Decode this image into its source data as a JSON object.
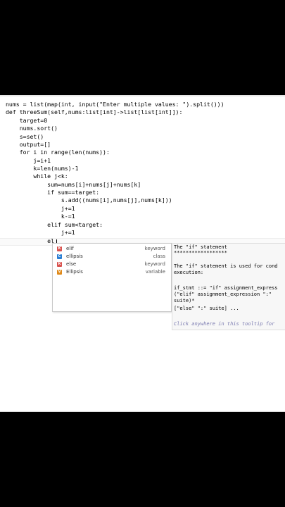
{
  "code": {
    "lines": [
      "nums = list(map(int, input(\"Enter multiple values: \").split()))",
      "def threeSum(self,nums:list[int]->list[list[int]]):",
      "    target=0",
      "    nums.sort()",
      "    s=set()",
      "    output=[]",
      "    for i in range(len(nums)):",
      "        j=i+1",
      "        k=len(nums)-1",
      "        while j<k:",
      "            sum=nums[i]+nums[j]+nums[k]",
      "            if sum==target:",
      "                s.add((nums[i],nums[j],nums[k]))",
      "                j+=1",
      "                k-=1",
      "            elif sum<target:",
      "                j+=1",
      "            el"
    ]
  },
  "completion": {
    "items": [
      {
        "label": "elif",
        "type": "keyword",
        "icon": "keyword-icon",
        "color": "#d9534f"
      },
      {
        "label": "ellipsis",
        "type": "class",
        "icon": "class-icon",
        "color": "#2a7fd4"
      },
      {
        "label": "else",
        "type": "keyword",
        "icon": "keyword-icon",
        "color": "#d9534f"
      },
      {
        "label": "Ellipsis",
        "type": "variable",
        "icon": "variable-icon",
        "color": "#e08a1a"
      }
    ]
  },
  "tooltip": {
    "title": "The \"if\" statement",
    "rule": "******************",
    "desc1": "The \"if\" statement is used for cond",
    "desc2": "execution:",
    "g1": "if_stmt ::= \"if\" assignment_express",
    "g2": "(\"elif\" assignment_expression \":\"",
    "g3": "suite)*",
    "g4": "[\"else\" \":\" suite] ...",
    "hint": "Click anywhere in this tooltip for"
  }
}
